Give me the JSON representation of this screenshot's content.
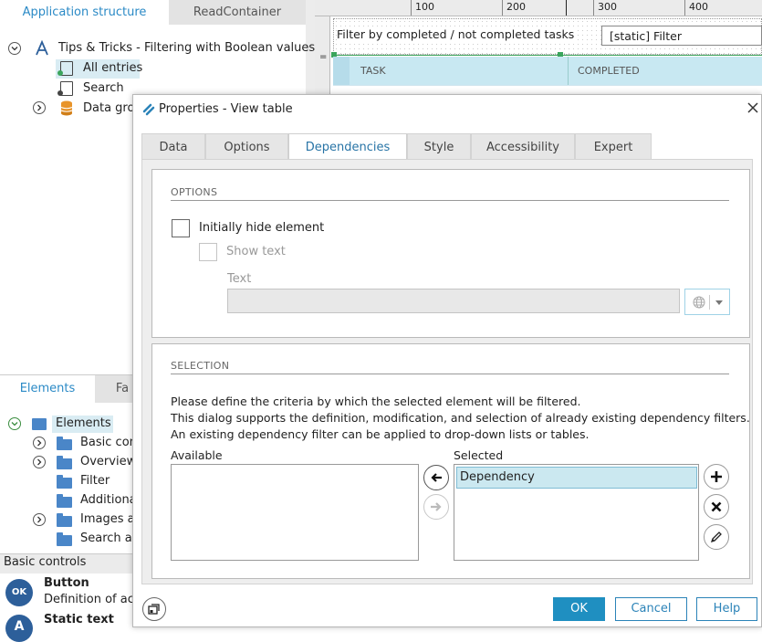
{
  "left_panel": {
    "top_tabs": [
      "Application structure",
      "ReadContainer"
    ],
    "tree": {
      "root": "Tips & Tricks - Filtering with Boolean values",
      "items": [
        "All entries",
        "Search",
        "Data grou"
      ]
    },
    "bottom_tabs": [
      "Elements",
      "Fa"
    ],
    "elements_tree": {
      "root": "Elements",
      "items": [
        "Basic cont",
        "Overview",
        "Filter",
        "Additiona",
        "Images an",
        "Search an"
      ]
    },
    "basic_controls_header": "Basic controls",
    "controls": [
      {
        "icon_text": "OK",
        "name": "Button",
        "desc": "Definition of acti"
      },
      {
        "icon_text": "A",
        "name": "Static text",
        "desc": ""
      }
    ]
  },
  "canvas": {
    "ruler_labels": [
      "100",
      "200",
      "300",
      "400"
    ],
    "filter_label": "Filter by completed / not completed tasks",
    "static_filter": "[static] Filter",
    "columns": [
      "TASK",
      "COMPLETED"
    ]
  },
  "dialog": {
    "title": "Properties - View table",
    "tabs": [
      "Data",
      "Options",
      "Dependencies",
      "Style",
      "Accessibility",
      "Expert"
    ],
    "active_tab": "Dependencies",
    "options": {
      "title": "OPTIONS",
      "initially_hide": "Initially hide element",
      "show_text": "Show text",
      "text_label": "Text",
      "text_value": ""
    },
    "selection": {
      "title": "SELECTION",
      "desc": [
        "Please define the criteria by which the selected element will be filtered.",
        "This dialog supports the definition, modification, and selection of already existing dependency filters.",
        "An existing dependency filter can be applied to drop-down lists or tables."
      ],
      "available_label": "Available",
      "selected_label": "Selected",
      "available_items": [],
      "selected_items": [
        "Dependency"
      ]
    },
    "buttons": {
      "ok": "OK",
      "cancel": "Cancel",
      "help": "Help"
    }
  },
  "colors": {
    "accent": "#1f8fc1",
    "link": "#2874a6",
    "selected_bg": "#cbe8f0"
  }
}
